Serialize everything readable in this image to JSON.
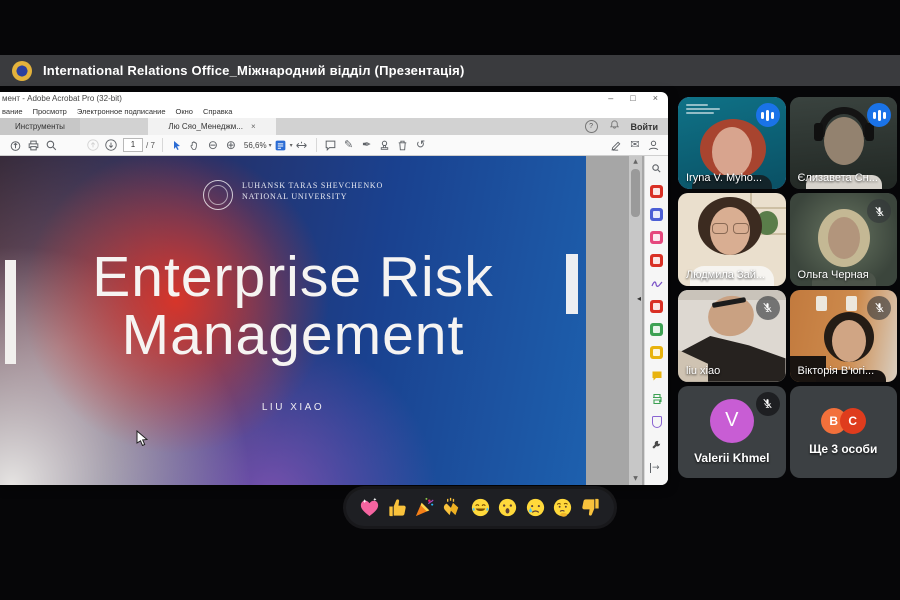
{
  "meet": {
    "header": {
      "title": "International Relations Office_Міжнародний відділ (Презентація)"
    },
    "participants": [
      {
        "name": "Iryna V. Myho...",
        "status": "speaking"
      },
      {
        "name": "Єлизавета Сн...",
        "status": "speaking"
      },
      {
        "name": "Людмила Зай...",
        "status": "camera-on"
      },
      {
        "name": "Ольга Черная",
        "status": "muted"
      },
      {
        "name": "liu xiao",
        "status": "muted"
      },
      {
        "name": "Вікторія В'югі...",
        "status": "muted"
      },
      {
        "name": "Valerii Khmel",
        "status": "muted",
        "avatar_letter": "V",
        "avatar_color": "#c85dd4"
      }
    ],
    "more_tile": {
      "label": "Ще 3 особи",
      "avatars": [
        "B",
        "C"
      ],
      "avatar_colors": [
        "#f2703b",
        "#df3c1d"
      ]
    },
    "reactions": [
      "sparkling-heart",
      "thumbs-up",
      "party-popper",
      "clapping-hands",
      "face-with-tears-of-joy",
      "astonished-face",
      "crying-face",
      "thinking-face",
      "thumbs-down"
    ]
  },
  "acrobat": {
    "window_title": "мент - Adobe Acrobat Pro (32-bit)",
    "menu_items": [
      "вание",
      "Просмотр",
      "Электронное подписание",
      "Окно",
      "Справка"
    ],
    "tabs": {
      "tools": "Инструменты",
      "document": "Лю Сяо_Менеджм..."
    },
    "sign_in": "Войти",
    "toolbar": {
      "page_current": "1",
      "page_total_label": "/ 7",
      "zoom_level": "56,6%"
    },
    "tools_panel_icons": [
      "search",
      "create-pdf",
      "combine-files",
      "organize-pages",
      "export-pdf",
      "fill-sign",
      "edit-pdf",
      "export-excel",
      "request-signatures",
      "comment",
      "print",
      "protect",
      "more-tools"
    ],
    "slide": {
      "org_line1": "LUHANSK TARAS SHEVCHENKO",
      "org_line2": "NATIONAL UNIVERSITY",
      "title_line1": "Enterprise Risk",
      "title_line2": "Management",
      "author": "LIU XIAO"
    }
  },
  "glyphs": {
    "minimize": "–",
    "maximize": "□",
    "close": "×",
    "tab_close": "×",
    "dropdown": "▾",
    "zoom_out": "⊖",
    "zoom_in": "⊕",
    "pencil": "✎",
    "sign": "✒",
    "fill_sign": "✒",
    "envelope": "✉",
    "undo": "↺",
    "help": "?",
    "up_arrow": "▲",
    "down_arrow": "▼",
    "collapse": "◂",
    "expand": "→"
  },
  "colors": {
    "accent_blue": "#1a73e8",
    "speaking_border": "#7baaf7",
    "tile_bg": "#3c4043"
  }
}
